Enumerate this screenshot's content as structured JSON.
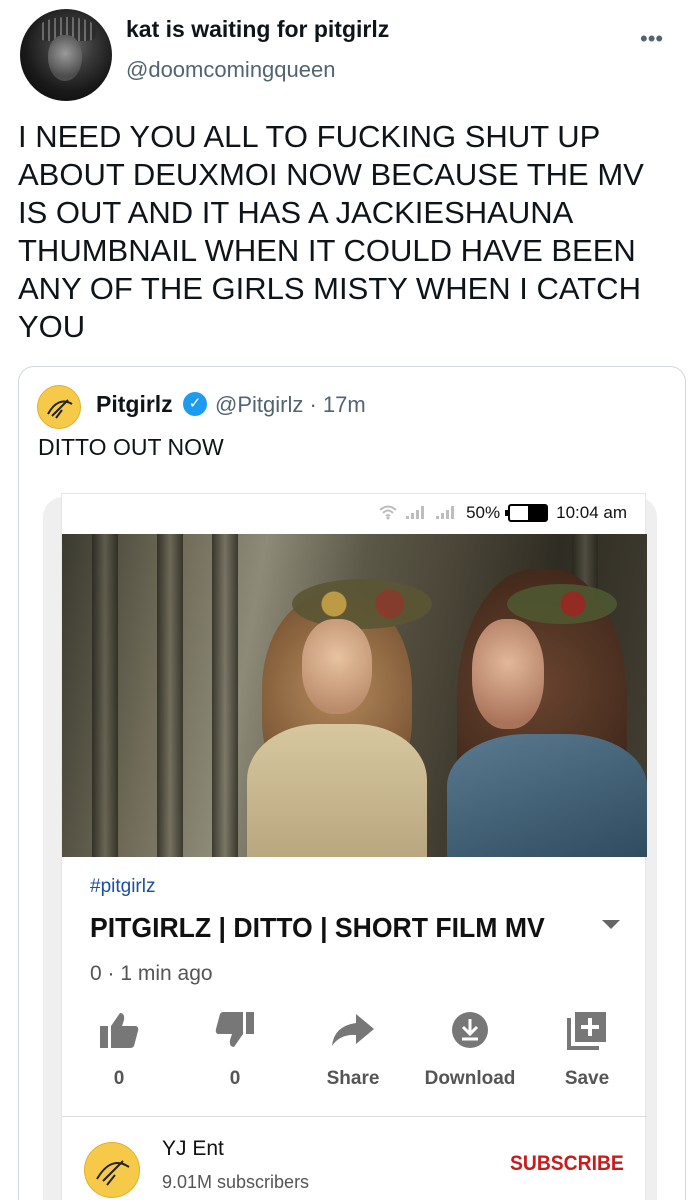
{
  "tweet": {
    "display_name": "kat is waiting for pitgirlz",
    "handle": "@doomcomingqueen",
    "more_icon": "•••",
    "text": "I NEED YOU ALL TO FUCKING SHUT UP ABOUT DEUXMOI NOW BECAUSE THE MV IS OUT AND IT HAS A JACKIESHAUNA THUMBNAIL WHEN IT COULD HAVE BEEN ANY OF THE GIRLS MISTY WHEN I CATCH YOU"
  },
  "quote": {
    "name": "Pitgirlz",
    "verified_icon": "✓",
    "handle_time": "@Pitgirlz · 17m",
    "text": "DITTO OUT NOW",
    "screenshot": {
      "status_bar": {
        "battery": "50%",
        "time": "10:04 am"
      },
      "hashtag": "#pitgirlz",
      "video_title": "PITGIRLZ | DITTO | SHORT FILM MV",
      "video_meta": "0  · 1 min ago",
      "actions": [
        {
          "icon": "thumbs-up-icon",
          "label": "0"
        },
        {
          "icon": "thumbs-down-icon",
          "label": "0"
        },
        {
          "icon": "share-icon",
          "label": "Share"
        },
        {
          "icon": "download-icon",
          "label": "Download"
        },
        {
          "icon": "save-icon",
          "label": "Save"
        }
      ],
      "channel": {
        "name": "YJ Ent",
        "subscribers": "9.01M subscribers",
        "subscribe_label": "SUBSCRIBE"
      }
    }
  }
}
